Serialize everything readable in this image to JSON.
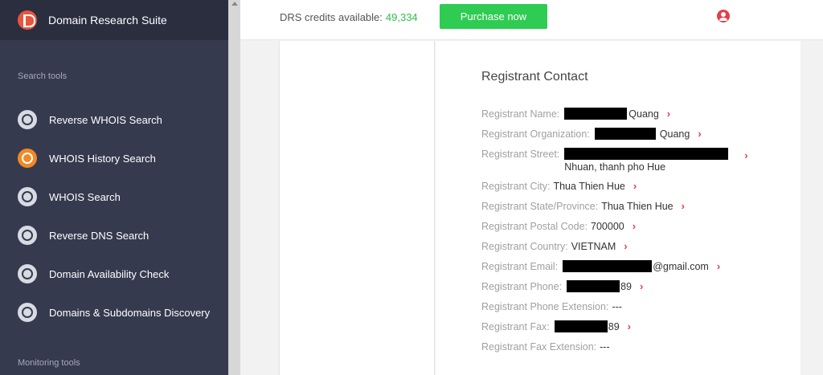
{
  "app": {
    "title": "Domain Research Suite"
  },
  "sidebar": {
    "section_search": "Search tools",
    "section_monitoring": "Monitoring tools",
    "items": [
      {
        "label": "Reverse WHOIS Search",
        "icon": "reverse-whois-icon"
      },
      {
        "label": "WHOIS History Search",
        "icon": "history-icon",
        "active": true
      },
      {
        "label": "WHOIS Search",
        "icon": "whois-search-icon"
      },
      {
        "label": "Reverse DNS Search",
        "icon": "globe-icon"
      },
      {
        "label": "Domain Availability Check",
        "icon": "availability-icon"
      },
      {
        "label": "Domains & Subdomains Discovery",
        "icon": "discovery-icon"
      }
    ]
  },
  "header": {
    "credits_label": "DRS credits available:",
    "credits_value": "49,334",
    "purchase_label": "Purchase now",
    "user_icon": "user-icon"
  },
  "contact": {
    "title": "Registrant Contact",
    "name_label": "Registrant Name:",
    "name_value": "Quang",
    "org_label": "Registrant Organization:",
    "org_value": "Quang",
    "street_label": "Registrant Street:",
    "street_value": "Nhuan, thanh pho Hue",
    "city_label": "Registrant City:",
    "city_value": "Thua Thien Hue",
    "state_label": "Registrant State/Province:",
    "state_value": "Thua Thien Hue",
    "postal_label": "Registrant Postal Code:",
    "postal_value": "700000",
    "country_label": "Registrant Country:",
    "country_value": "VIETNAM",
    "email_label": "Registrant Email:",
    "email_value": "@gmail.com",
    "phone_label": "Registrant Phone:",
    "phone_value": "89",
    "phone_ext_label": "Registrant Phone Extension:",
    "phone_ext_value": "---",
    "fax_label": "Registrant Fax:",
    "fax_value": "89",
    "fax_ext_label": "Registrant Fax Extension:",
    "fax_ext_value": "---"
  },
  "colors": {
    "accent_green": "#2ecc52",
    "chevron_red": "#e53e4a",
    "sidebar_bg": "#363a4f",
    "active_orange": "#f08a24"
  }
}
